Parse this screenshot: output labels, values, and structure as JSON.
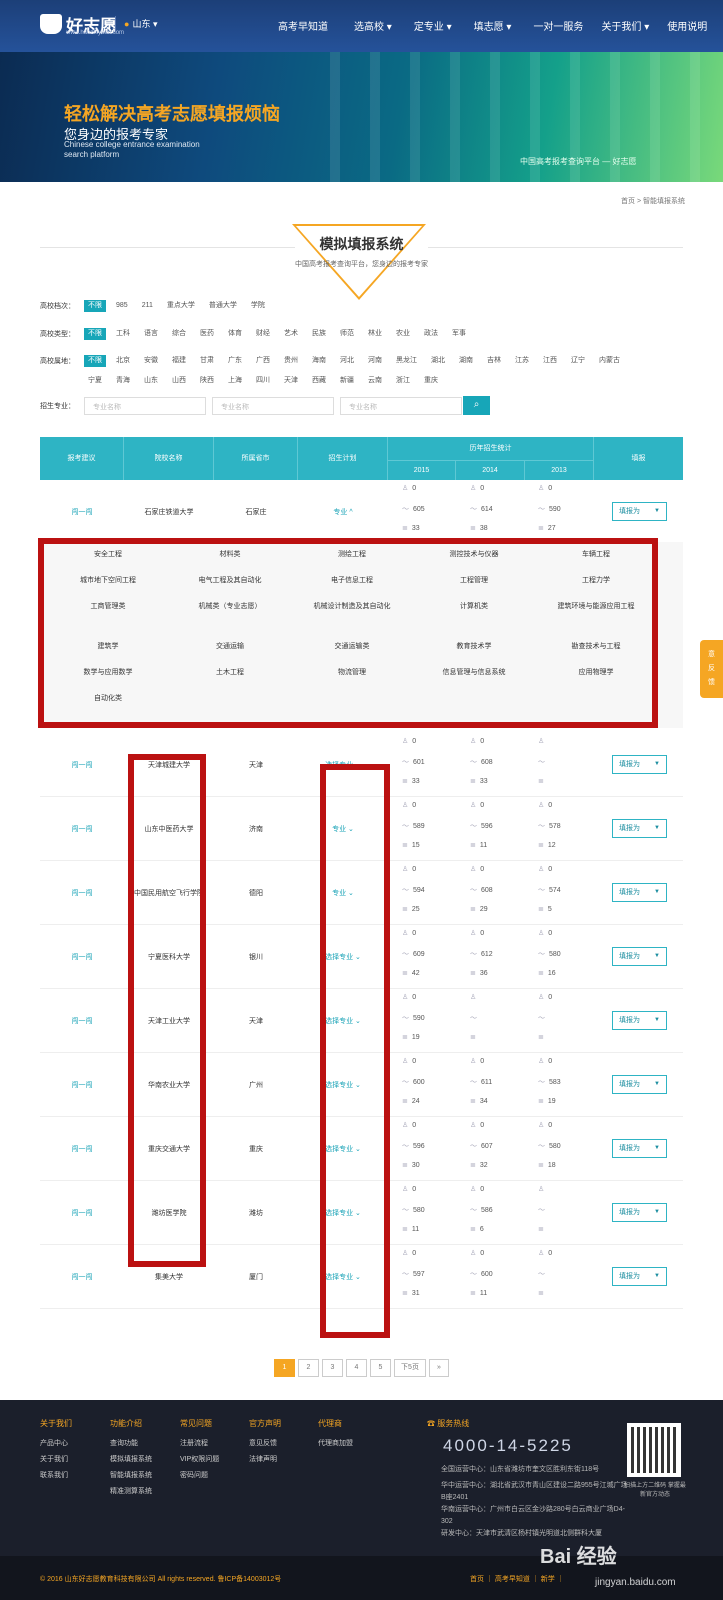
{
  "header": {
    "logo_text": "好志愿",
    "logo_sub": "www.haozhiyuan.com",
    "location": "山东",
    "nav": [
      "高考早知道",
      "选高校",
      "定专业",
      "填志愿",
      "一对一服务",
      "关于我们",
      "使用说明"
    ]
  },
  "banner": {
    "headline": "轻松解决高考志愿填报烦恼",
    "sub": "您身边的报考专家",
    "en": "Chinese college entrance examination search platform",
    "right": "中国高考报考查询平台 — 好志愿"
  },
  "breadcrumb": [
    "首页",
    "智能填报系统"
  ],
  "title": "模拟填报系统",
  "subtitle": "中国高考报考查询平台，您身边的报考专家",
  "filters": {
    "levels_label": "高校档次：",
    "levels": [
      "不限",
      "985",
      "211",
      "重点大学",
      "普通大学",
      "学院"
    ],
    "types_label": "高校类型：",
    "types": [
      "不限",
      "工科",
      "语言",
      "综合",
      "医药",
      "体育",
      "财经",
      "艺术",
      "民族",
      "师范",
      "林业",
      "农业",
      "政法",
      "军事"
    ],
    "regions_label": "高校属地：",
    "regions": [
      "不限",
      "北京",
      "安徽",
      "福建",
      "甘肃",
      "广东",
      "广西",
      "贵州",
      "海南",
      "河北",
      "河南",
      "黑龙江",
      "湖北",
      "湖南",
      "吉林",
      "江苏",
      "江西",
      "辽宁",
      "内蒙古",
      "宁夏",
      "青海",
      "山东",
      "山西",
      "陕西",
      "上海",
      "四川",
      "天津",
      "西藏",
      "新疆",
      "云南",
      "浙江",
      "重庆"
    ],
    "major_label": "招生专业：",
    "major_placeholder": "专业名称"
  },
  "table": {
    "headers": {
      "advice": "报考建议",
      "school": "院校名称",
      "city": "所属省市",
      "plan": "招生计划",
      "history": "历年招生统计",
      "years": [
        "2015",
        "2014",
        "2013"
      ],
      "fill": "填报"
    },
    "advice_link": "闯一闯",
    "fill_button": "填报为",
    "rows": [
      {
        "school": "石家庄铁道大学",
        "city": "石家庄",
        "plan": "专业 ^",
        "stats": [
          [
            "0",
            "605",
            "33"
          ],
          [
            "0",
            "614",
            "38"
          ],
          [
            "0",
            "590",
            "27"
          ]
        ]
      },
      {
        "school": "天津城建大学",
        "city": "天津",
        "plan": "选择专业 ⌄",
        "stats": [
          [
            "0",
            "601",
            "33"
          ],
          [
            "0",
            "608",
            "33"
          ],
          [
            "",
            "",
            ""
          ]
        ]
      },
      {
        "school": "山东中医药大学",
        "city": "济南",
        "plan": "专业 ⌄",
        "stats": [
          [
            "0",
            "589",
            "15"
          ],
          [
            "0",
            "596",
            "11"
          ],
          [
            "0",
            "578",
            "12"
          ]
        ]
      },
      {
        "school": "中国民用航空飞行学院",
        "city": "德阳",
        "plan": "专业 ⌄",
        "stats": [
          [
            "0",
            "594",
            "25"
          ],
          [
            "0",
            "608",
            "29"
          ],
          [
            "0",
            "574",
            "5"
          ]
        ]
      },
      {
        "school": "宁夏医科大学",
        "city": "银川",
        "plan": "选择专业 ⌄",
        "stats": [
          [
            "0",
            "609",
            "42"
          ],
          [
            "0",
            "612",
            "36"
          ],
          [
            "0",
            "580",
            "16"
          ]
        ]
      },
      {
        "school": "天津工业大学",
        "city": "天津",
        "plan": "选择专业 ⌄",
        "stats": [
          [
            "0",
            "590",
            "19"
          ],
          [
            "",
            "",
            ""
          ],
          [
            "0",
            "",
            ""
          ]
        ]
      },
      {
        "school": "华南农业大学",
        "city": "广州",
        "plan": "选择专业 ⌄",
        "stats": [
          [
            "0",
            "600",
            "24"
          ],
          [
            "0",
            "611",
            "34"
          ],
          [
            "0",
            "583",
            "19"
          ]
        ]
      },
      {
        "school": "重庆交通大学",
        "city": "重庆",
        "plan": "选择专业 ⌄",
        "stats": [
          [
            "0",
            "596",
            "30"
          ],
          [
            "0",
            "607",
            "32"
          ],
          [
            "0",
            "580",
            "18"
          ]
        ]
      },
      {
        "school": "潍坊医学院",
        "city": "潍坊",
        "plan": "选择专业 ⌄",
        "stats": [
          [
            "0",
            "580",
            "11"
          ],
          [
            "0",
            "586",
            "6"
          ],
          [
            "",
            "",
            ""
          ]
        ]
      },
      {
        "school": "集美大学",
        "city": "厦门",
        "plan": "选择专业 ⌄",
        "stats": [
          [
            "0",
            "597",
            "31"
          ],
          [
            "0",
            "600",
            "11"
          ],
          [
            "0",
            "",
            ""
          ]
        ]
      }
    ],
    "majors": [
      "安全工程",
      "材料类",
      "测绘工程",
      "测控技术与仪器",
      "车辆工程",
      "城市地下空间工程",
      "电气工程及其自动化",
      "电子信息工程",
      "工程管理",
      "工程力学",
      "工商管理类",
      "机械类（专业志愿）",
      "机械设计制造及其自动化",
      "计算机类",
      "建筑环境与能源应用工程",
      "建筑学",
      "交通运输",
      "交通运输类",
      "教育技术学",
      "勘查技术与工程",
      "数学与应用数学",
      "土木工程",
      "物流管理",
      "信息管理与信息系统",
      "应用物理学",
      "自动化类"
    ]
  },
  "side_tab": [
    "意",
    "见",
    "反",
    "馈"
  ],
  "pagination": {
    "pages": [
      "1",
      "2",
      "3",
      "4",
      "5"
    ],
    "next": "下5页",
    "last": "»"
  },
  "footer": {
    "cols": [
      {
        "head": "关于我们",
        "items": [
          "产品中心",
          "关于我们",
          "联系我们"
        ]
      },
      {
        "head": "功能介绍",
        "items": [
          "查询功能",
          "模拟填报系统",
          "智能填报系统",
          "精准测算系统"
        ]
      },
      {
        "head": "常见问题",
        "items": [
          "注册流程",
          "VIP权限问题",
          "密码问题"
        ]
      },
      {
        "head": "官方声明",
        "items": [
          "意见反馈",
          "法律声明"
        ]
      },
      {
        "head": "代理商",
        "items": [
          "代理商加盟"
        ]
      }
    ],
    "hotline_label": "服务热线",
    "hotline": "4000-14-5225",
    "addresses": [
      "全国运营中心：山东省潍坊市奎文区胜利东街118号",
      "华中运营中心：湖北省武汉市青山区建设二路955号江城广场B座2401",
      "华南运营中心：广州市白云区金沙路280号白云商业广场D4-302",
      "研发中心：天津市武清区杨村镇光明道北侧群科大厦"
    ],
    "qr_caption": "扫描上方二维码 掌握最新官方动态",
    "copyright": "© 2016 山东好志愿教育科技有限公司 All rights reserved. 鲁ICP备14003012号",
    "links": "首页 ｜ 高考早知道 ｜ 新学 ｜",
    "watermark": "Bai 经验",
    "watermark_sub": "jingyan.baidu.com"
  }
}
